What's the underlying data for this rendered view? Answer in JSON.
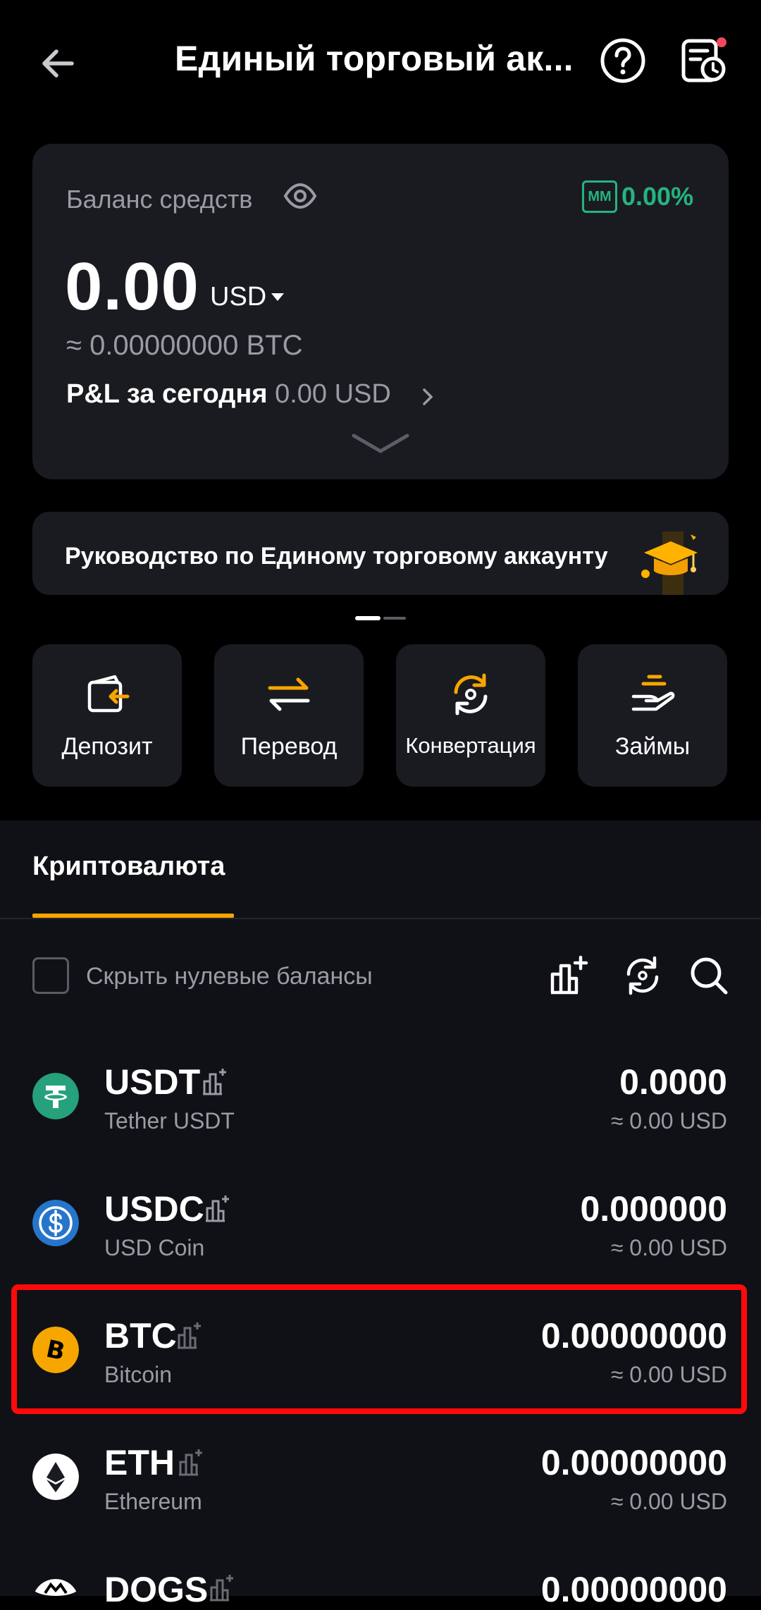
{
  "header": {
    "title": "Единый торговый ак...",
    "back_icon": "arrow-left-icon",
    "help_icon": "question-circle-icon",
    "history_icon": "history-clock-icon"
  },
  "balance_card": {
    "label": "Баланс средств",
    "mm_badge": "MM",
    "mm_percent": "0.00%",
    "amount": "0.00",
    "currency": "USD",
    "btc_equivalent": "≈ 0.00000000 BTC",
    "pnl_label": "P&L за сегодня",
    "pnl_value": "0.00 USD"
  },
  "guide_banner": {
    "text": "Руководство по Единому торговому аккаунту"
  },
  "actions": [
    {
      "label": "Депозит",
      "icon": "wallet-deposit-icon"
    },
    {
      "label": "Перевод",
      "icon": "transfer-arrows-icon"
    },
    {
      "label": "Конвертация",
      "icon": "convert-icon"
    },
    {
      "label": "Займы",
      "icon": "loan-hand-icon"
    }
  ],
  "tabs": {
    "active": "Криптовалюта"
  },
  "filters": {
    "hide_zero_label": "Скрыть нулевые балансы"
  },
  "assets": [
    {
      "symbol": "USDT",
      "name": "Tether USDT",
      "amount": "0.0000",
      "usd": "≈ 0.00 USD",
      "color": "#26a17b"
    },
    {
      "symbol": "USDC",
      "name": "USD Coin",
      "amount": "0.000000",
      "usd": "≈ 0.00 USD",
      "color": "#2775ca"
    },
    {
      "symbol": "BTC",
      "name": "Bitcoin",
      "amount": "0.00000000",
      "usd": "≈ 0.00 USD",
      "color": "#f7a600"
    },
    {
      "symbol": "ETH",
      "name": "Ethereum",
      "amount": "0.00000000",
      "usd": "≈ 0.00 USD",
      "color": "#ffffff"
    },
    {
      "symbol": "DOGS",
      "name": "",
      "amount": "0.00000000",
      "usd": "",
      "color": "#ffffff"
    }
  ],
  "colors": {
    "accent": "#f7a600",
    "positive": "#24b47e",
    "highlight": "#ff0a0a"
  }
}
